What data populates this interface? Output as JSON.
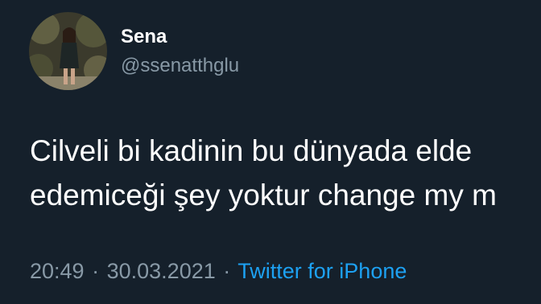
{
  "tweet": {
    "author": {
      "display_name": "Sena",
      "handle": "@ssenatthglu"
    },
    "text_lines": [
      "Cilveli bi kadinin bu dünyada elde",
      "edemiceği şey yoktur change my m"
    ],
    "time": "20:49",
    "date": "30.03.2021",
    "separator": "·",
    "source": "Twitter for iPhone"
  },
  "colors": {
    "background": "#15202b",
    "primary_text": "#ffffff",
    "secondary_text": "#8899a6",
    "link": "#1da1f2"
  }
}
